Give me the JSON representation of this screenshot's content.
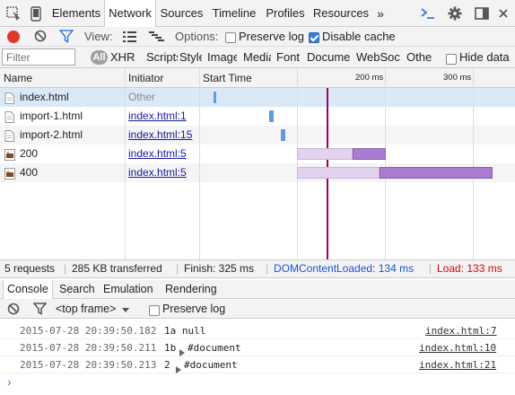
{
  "tabs": [
    {
      "label": "Elements",
      "active": false
    },
    {
      "label": "Network",
      "active": true
    },
    {
      "label": "Sources",
      "active": false
    },
    {
      "label": "Timeline",
      "active": false
    },
    {
      "label": "Profiles",
      "active": false
    },
    {
      "label": "Resources",
      "active": false
    }
  ],
  "tab_overflow": "»",
  "toolbar": {
    "view_label": "View:",
    "options_label": "Options:",
    "preserve_log": {
      "label": "Preserve log",
      "checked": false
    },
    "disable_cache": {
      "label": "Disable cache",
      "checked": true
    }
  },
  "filter": {
    "placeholder": "Filter",
    "types": [
      "All",
      "XHR",
      "Scripts",
      "Styles",
      "Images",
      "Media",
      "Fonts",
      "Documents",
      "WebSockets",
      "Other"
    ],
    "hide_data_urls": {
      "label": "Hide data",
      "checked": false
    }
  },
  "columns": {
    "name": "Name",
    "initiator": "Initiator",
    "start_time": "Start Time",
    "tick_200": "200 ms",
    "tick_300": "300 ms"
  },
  "requests": [
    {
      "name": "index.html",
      "initiator": "Other",
      "initiator_link": false,
      "icon": "document-icon",
      "selected": true
    },
    {
      "name": "import-1.html",
      "initiator": "index.html:1",
      "initiator_link": true,
      "icon": "document-icon",
      "selected": false
    },
    {
      "name": "import-2.html",
      "initiator": "index.html:15",
      "initiator_link": true,
      "icon": "document-icon",
      "selected": false
    },
    {
      "name": "200",
      "initiator": "index.html:5",
      "initiator_link": true,
      "icon": "image-icon",
      "selected": false
    },
    {
      "name": "400",
      "initiator": "index.html:5",
      "initiator_link": true,
      "icon": "image-icon",
      "selected": false
    }
  ],
  "status": {
    "requests": "5 requests",
    "transferred": "285 KB transferred",
    "finish": "Finish: 325 ms",
    "dom_content_loaded": "DOMContentLoaded: 134 ms",
    "load": "Load: 133 ms"
  },
  "drawer_tabs": [
    {
      "label": "Console",
      "active": true
    },
    {
      "label": "Search",
      "active": false
    },
    {
      "label": "Emulation",
      "active": false
    },
    {
      "label": "Rendering",
      "active": false
    }
  ],
  "console": {
    "frame_selector": "<top frame>",
    "preserve_log": {
      "label": "Preserve log",
      "checked": false
    },
    "messages": [
      {
        "timestamp": "2015-07-28 20:39:50.182",
        "text": "1a null",
        "expandable": false,
        "source": "index.html:7"
      },
      {
        "timestamp": "2015-07-28 20:39:50.211",
        "text": "1b",
        "expandable": true,
        "object": "#document",
        "source": "index.html:10"
      },
      {
        "timestamp": "2015-07-28 20:39:50.213",
        "text": "2",
        "expandable": true,
        "object": "#document",
        "source": "index.html:21"
      }
    ],
    "prompt": "›"
  },
  "colors": {
    "accent_blue": "#3b7ddd",
    "record_red": "#e0392b",
    "dcl_line": "#a0005a",
    "load_red": "#e60000",
    "dcl_blue": "#1a52d9",
    "link": "#1a1aa6",
    "selected_row": "#dbe9f7",
    "bar_image": "#a97ccf"
  }
}
